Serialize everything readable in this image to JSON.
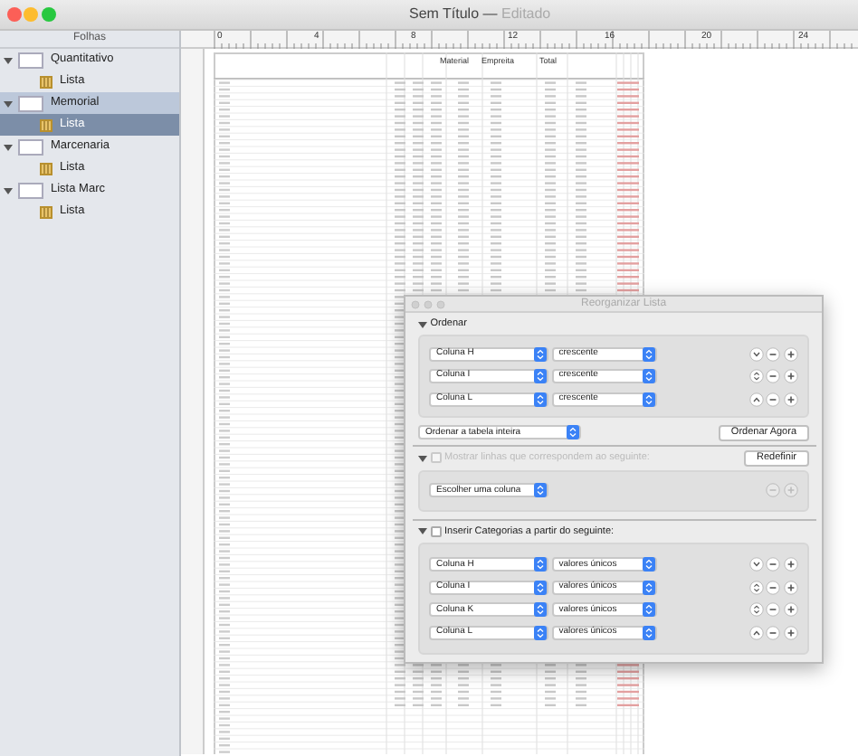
{
  "window": {
    "title": "Sem Título",
    "separator": "—",
    "state": "Editado"
  },
  "sidebar": {
    "header": "Folhas",
    "items": [
      {
        "name": "Quantitativo",
        "selected": false,
        "expanded": true,
        "children": [
          {
            "name": "Lista",
            "selected": false
          }
        ]
      },
      {
        "name": "Memorial",
        "selected": true,
        "expanded": true,
        "children": [
          {
            "name": "Lista",
            "selected": true
          }
        ]
      },
      {
        "name": "Marcenaria",
        "selected": false,
        "expanded": true,
        "children": [
          {
            "name": "Lista",
            "selected": false
          }
        ]
      },
      {
        "name": "Lista Marc",
        "selected": false,
        "expanded": true,
        "children": [
          {
            "name": "Lista",
            "selected": false
          }
        ]
      }
    ]
  },
  "ruler": {
    "labels": [
      "0",
      "4",
      "8",
      "12",
      "16",
      "20",
      "24"
    ]
  },
  "sheet": {
    "columns": [
      "Material",
      "Empreita",
      "Total"
    ]
  },
  "dialog": {
    "title": "Reorganizar Lista",
    "sort": {
      "label": "Ordenar",
      "expanded": true,
      "rules": [
        {
          "column": "Coluna H",
          "order": "crescente"
        },
        {
          "column": "Coluna I",
          "order": "crescente"
        },
        {
          "column": "Coluna L",
          "order": "crescente"
        }
      ],
      "scope": "Ordenar a tabela inteira",
      "button": "Ordenar Agora"
    },
    "filter": {
      "label": "Mostrar linhas que correspondem ao seguinte:",
      "expanded": true,
      "checked": false,
      "disabled": true,
      "button": "Redefinir",
      "column": "Escolher uma coluna"
    },
    "categories": {
      "label": "Inserir Categorias a partir do seguinte:",
      "expanded": true,
      "checked": false,
      "rules": [
        {
          "column": "Coluna H",
          "mode": "valores únicos"
        },
        {
          "column": "Coluna I",
          "mode": "valores únicos"
        },
        {
          "column": "Coluna K",
          "mode": "valores únicos"
        },
        {
          "column": "Coluna L",
          "mode": "valores únicos"
        }
      ]
    }
  }
}
